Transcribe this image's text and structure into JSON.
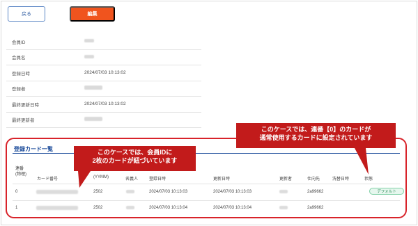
{
  "toolbar": {
    "back_label": "戻る",
    "edit_label": "編集"
  },
  "member_info": [
    {
      "label": "会員ID",
      "value": ""
    },
    {
      "label": "会員名",
      "value": ""
    },
    {
      "label": "登録日時",
      "value": "2024/07/03 10:13:02"
    },
    {
      "label": "登録者",
      "value": ""
    },
    {
      "label": "最終更新日時",
      "value": "2024/07/03 10:13:02"
    },
    {
      "label": "最終更新者",
      "value": ""
    }
  ],
  "cards": {
    "title": "登録カード一覧",
    "headers": {
      "seq": "連番\n(物理)",
      "card_number": "カード番号",
      "expiry": "(YYMM)",
      "holder": "名義人",
      "registered_at": "登録日時",
      "updated_at": "更新日時",
      "updated_by": "更新者",
      "destination": "仕向先",
      "closing_date": "洗替日時",
      "status": "状態"
    },
    "rows": [
      {
        "seq": "0",
        "card_number": "",
        "expiry": "2502",
        "holder": "",
        "registered_at": "2024/07/03 10:13:03",
        "updated_at": "2024/07/03 10:13:03",
        "updated_by": "",
        "destination": "2a99662",
        "closing_date": "",
        "status": "デフォルト"
      },
      {
        "seq": "1",
        "card_number": "",
        "expiry": "2502",
        "holder": "",
        "registered_at": "2024/07/03 10:13:04",
        "updated_at": "2024/07/03 10:13:04",
        "updated_by": "",
        "destination": "2a99662",
        "closing_date": "",
        "status": ""
      }
    ]
  },
  "callouts": {
    "left_line1": "このケースでは、会員IDに",
    "left_line2": "2枚のカードが紐づいています",
    "right_line1": "このケースでは、連番【0】のカードが",
    "right_line2": "通常使用するカードに設定されています"
  },
  "colors": {
    "accent_orange": "#f0541e",
    "annotation_red": "#c21b1b",
    "link_blue": "#1f4e9c",
    "default_badge_green": "#2a8a55"
  }
}
